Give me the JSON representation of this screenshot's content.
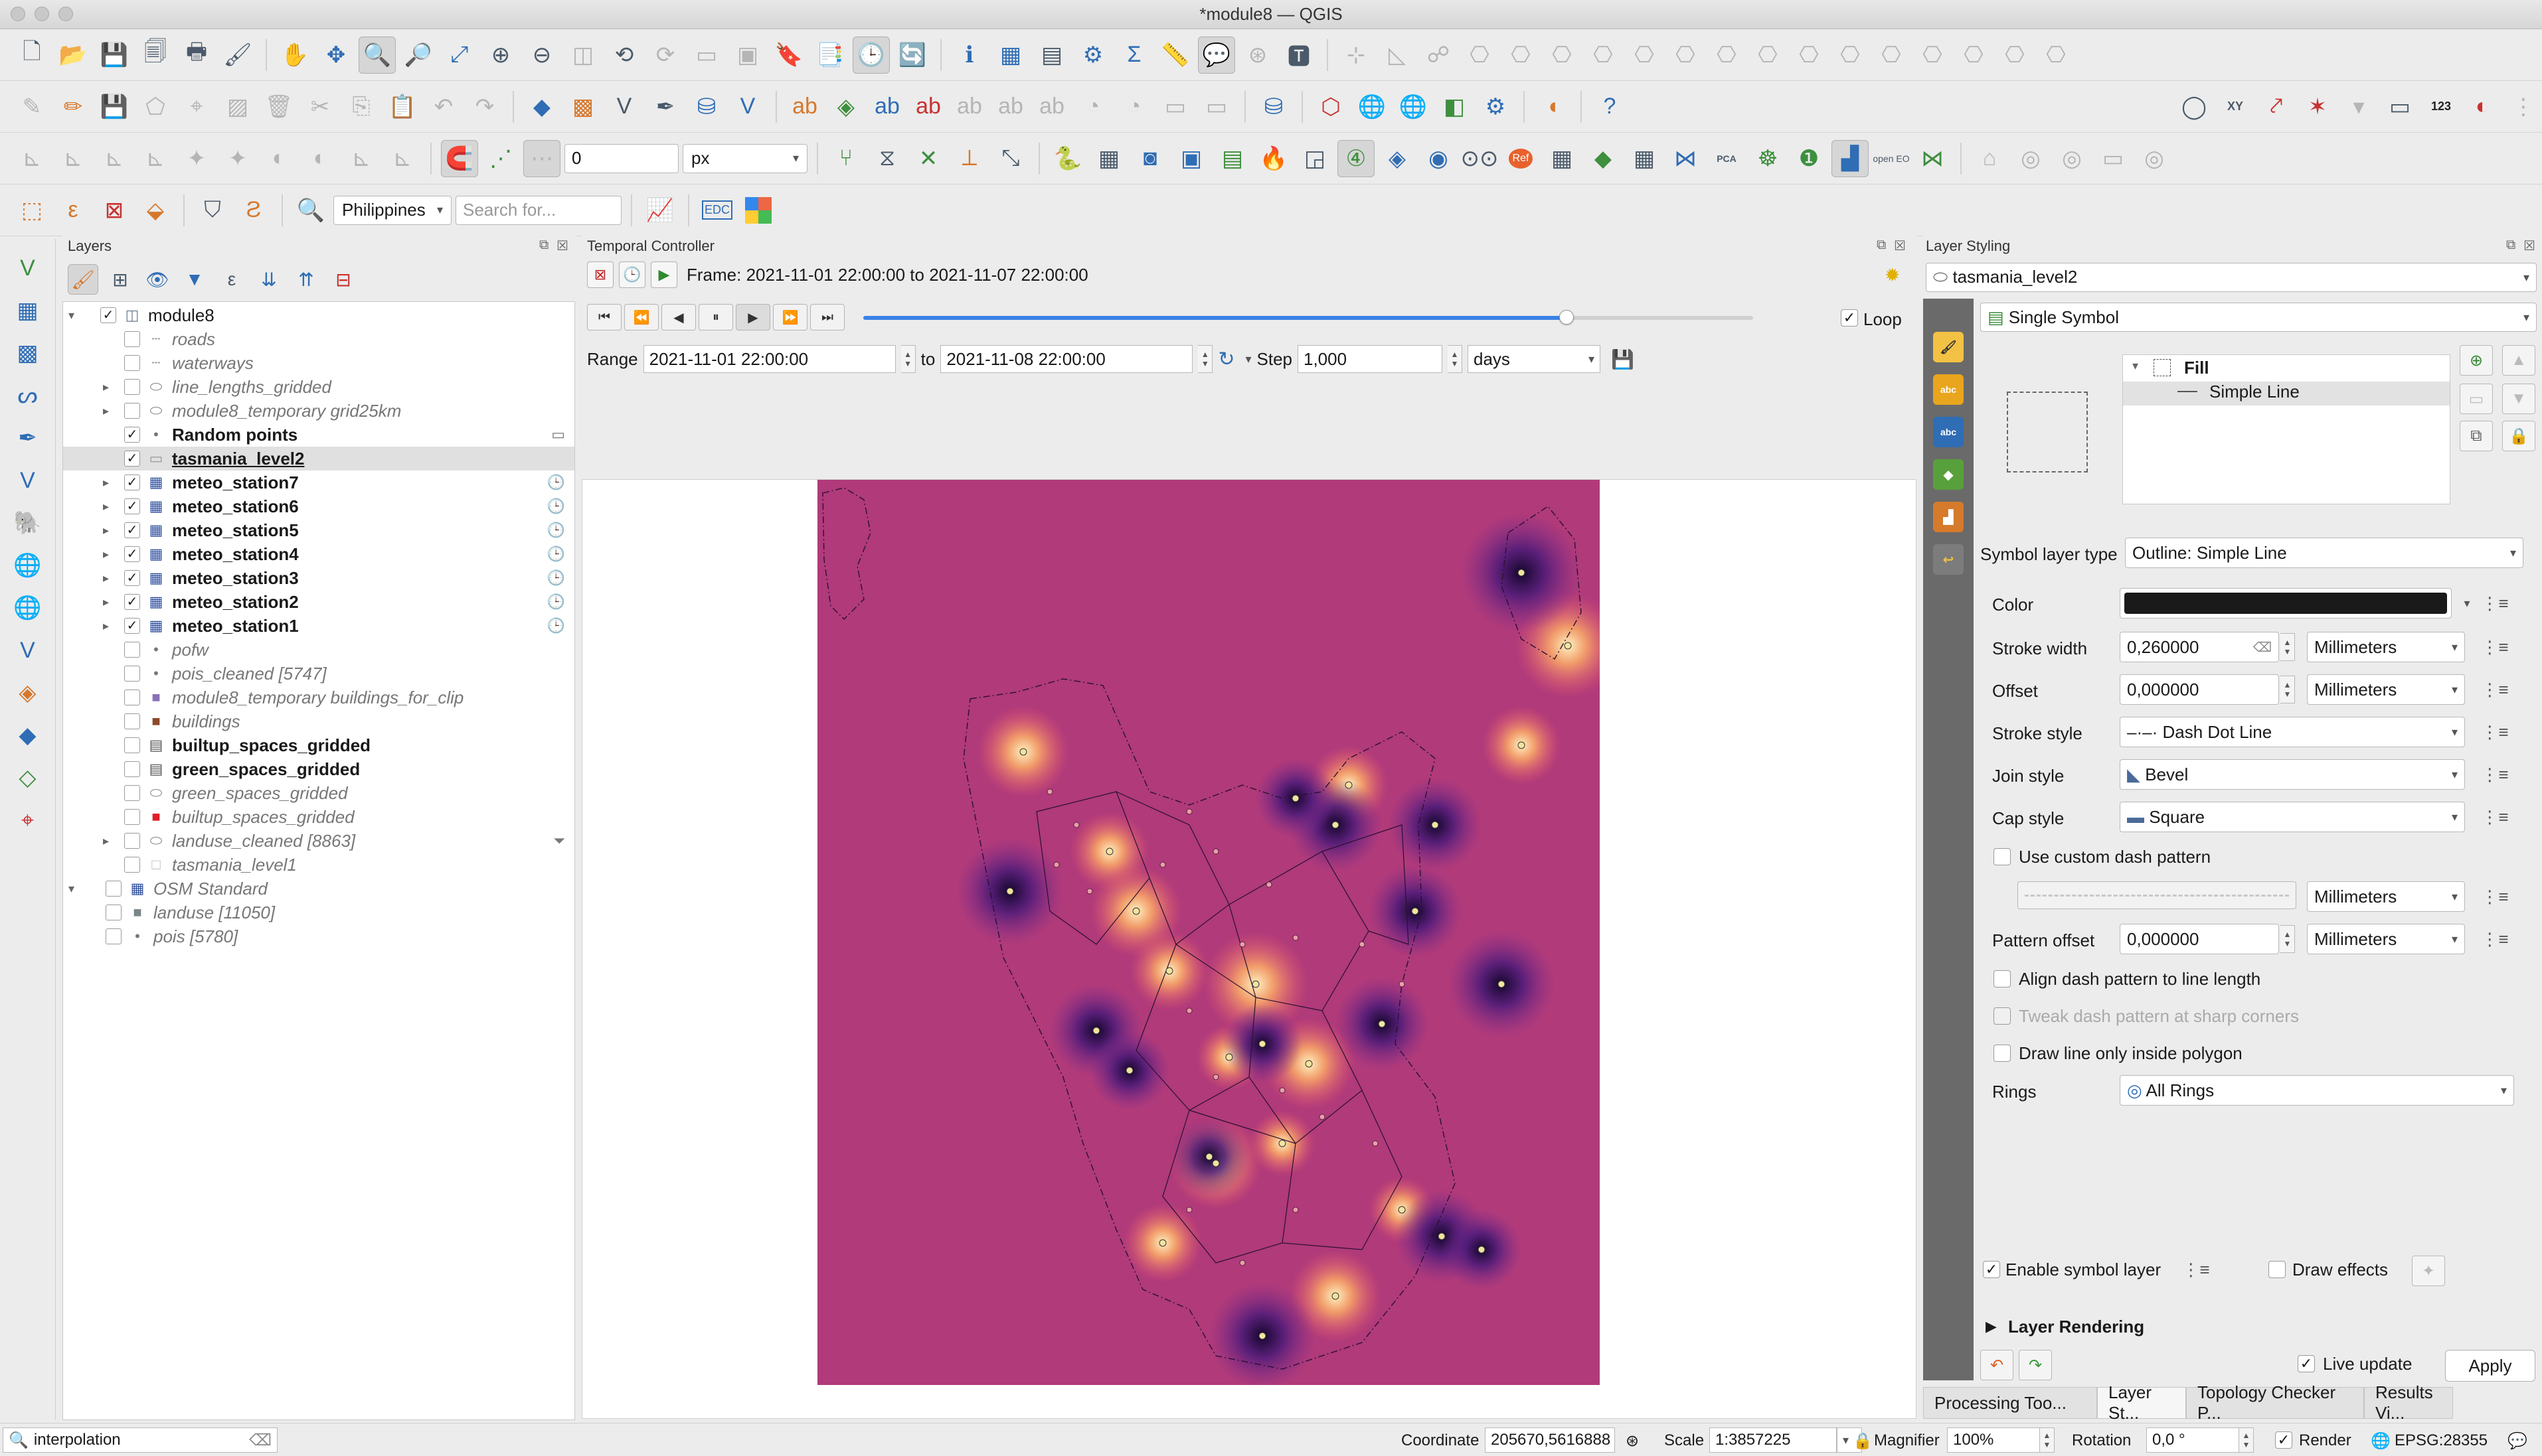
{
  "window": {
    "title": "*module8 — QGIS"
  },
  "toolbar": {
    "snap_value": "0",
    "snap_unit": "px",
    "locale_select": "Philippines",
    "search_placeholder": "Search for...",
    "edc_label": "EDC",
    "n123_label": "123",
    "xy_label": "XY",
    "open_eo_label": "open EO",
    "pca_label": "PCA",
    "ref_label": "Ref"
  },
  "layers_panel": {
    "title": "Layers",
    "items": [
      {
        "label": "module8",
        "style": "normal",
        "checked": true,
        "expand": "open",
        "indent": 0,
        "icon": "project-icon"
      },
      {
        "label": "roads",
        "style": "ital",
        "checked": false,
        "expand": "",
        "indent": 1,
        "icon": "line-icon"
      },
      {
        "label": "waterways",
        "style": "ital",
        "checked": false,
        "expand": "",
        "indent": 1,
        "icon": "line-icon"
      },
      {
        "label": "line_lengths_gridded",
        "style": "ital",
        "checked": false,
        "expand": "closed",
        "indent": 1,
        "icon": "polygon-icon"
      },
      {
        "label": "module8_temporary grid25km",
        "style": "ital",
        "checked": false,
        "expand": "closed",
        "indent": 1,
        "icon": "polygon-icon"
      },
      {
        "label": "Random points",
        "style": "bold",
        "checked": true,
        "expand": "",
        "indent": 1,
        "icon": "point-icon",
        "right": "memory-icon"
      },
      {
        "label": "tasmania_level2",
        "style": "bold",
        "checked": true,
        "expand": "",
        "indent": 1,
        "icon": "polygon-outline-icon",
        "selected": true
      },
      {
        "label": "meteo_station7",
        "style": "bold",
        "checked": true,
        "expand": "closed",
        "indent": 1,
        "icon": "raster-icon",
        "right": "clock-icon"
      },
      {
        "label": "meteo_station6",
        "style": "bold",
        "checked": true,
        "expand": "closed",
        "indent": 1,
        "icon": "raster-icon",
        "right": "clock-icon"
      },
      {
        "label": "meteo_station5",
        "style": "bold",
        "checked": true,
        "expand": "closed",
        "indent": 1,
        "icon": "raster-icon",
        "right": "clock-icon"
      },
      {
        "label": "meteo_station4",
        "style": "bold",
        "checked": true,
        "expand": "closed",
        "indent": 1,
        "icon": "raster-icon",
        "right": "clock-icon"
      },
      {
        "label": "meteo_station3",
        "style": "bold",
        "checked": true,
        "expand": "closed",
        "indent": 1,
        "icon": "raster-icon",
        "right": "clock-icon"
      },
      {
        "label": "meteo_station2",
        "style": "bold",
        "checked": true,
        "expand": "closed",
        "indent": 1,
        "icon": "raster-icon",
        "right": "clock-icon"
      },
      {
        "label": "meteo_station1",
        "style": "bold",
        "checked": true,
        "expand": "closed",
        "indent": 1,
        "icon": "raster-icon",
        "right": "clock-icon"
      },
      {
        "label": "pofw",
        "style": "ital",
        "checked": false,
        "expand": "",
        "indent": 1,
        "icon": "point-icon"
      },
      {
        "label": "pois_cleaned [5747]",
        "style": "ital",
        "checked": false,
        "expand": "",
        "indent": 1,
        "icon": "point-icon"
      },
      {
        "label": "module8_temporary buildings_for_clip",
        "style": "ital",
        "checked": false,
        "expand": "",
        "indent": 1,
        "icon": "purple-fill-icon"
      },
      {
        "label": "buildings",
        "style": "ital",
        "checked": false,
        "expand": "",
        "indent": 1,
        "icon": "brown-fill-icon"
      },
      {
        "label": "builtup_spaces_gridded",
        "style": "bold",
        "checked": false,
        "expand": "",
        "indent": 0,
        "icon": "table-icon"
      },
      {
        "label": "green_spaces_gridded",
        "style": "bold",
        "checked": false,
        "expand": "",
        "indent": 0,
        "icon": "table-icon"
      },
      {
        "label": "green_spaces_gridded",
        "style": "ital",
        "checked": false,
        "expand": "",
        "indent": 1,
        "icon": "polygon-icon"
      },
      {
        "label": "builtup_spaces_gridded",
        "style": "ital",
        "checked": false,
        "expand": "",
        "indent": 1,
        "icon": "red-fill-icon"
      },
      {
        "label": "landuse_cleaned [8863]",
        "style": "ital",
        "checked": false,
        "expand": "closed",
        "indent": 1,
        "icon": "polygon-icon",
        "right": "filter-icon"
      },
      {
        "label": "tasmania_level1",
        "style": "ital",
        "checked": false,
        "expand": "",
        "indent": 1,
        "icon": "empty-fill-icon"
      },
      {
        "label": "OSM Standard",
        "style": "ital",
        "checked": false,
        "expand": "open",
        "indent": -1,
        "icon": "raster-icon"
      },
      {
        "label": "landuse [11050]",
        "style": "ital",
        "checked": false,
        "expand": "",
        "indent": -1,
        "icon": "grey-fill-icon"
      },
      {
        "label": "pois [5780]",
        "style": "ital",
        "checked": false,
        "expand": "",
        "indent": -1,
        "icon": "point-icon"
      }
    ]
  },
  "temporal": {
    "title": "Temporal Controller",
    "frame_text": "Frame: 2021-11-01 22:00:00 to 2021-11-07 22:00:00",
    "progress": 0.79,
    "loop_label": "Loop",
    "range_label": "Range",
    "range_start": "2021-11-01 22:00:00",
    "to_label": "to",
    "range_end": "2021-11-08 22:00:00",
    "step_label": "Step",
    "step_value": "1,000",
    "step_unit": "days"
  },
  "styling": {
    "title": "Layer Styling",
    "layer_select": "tasmania_level2",
    "renderer": "Single Symbol",
    "tree_fill": "Fill",
    "tree_line": "Simple Line",
    "symbol_layer_type_label": "Symbol layer type",
    "symbol_layer_type": "Outline: Simple Line",
    "color_label": "Color",
    "stroke_width_label": "Stroke width",
    "stroke_width": "0,260000",
    "stroke_width_unit": "Millimeters",
    "offset_label": "Offset",
    "offset": "0,000000",
    "offset_unit": "Millimeters",
    "stroke_style_label": "Stroke style",
    "stroke_style": "Dash Dot Line",
    "join_style_label": "Join style",
    "join_style": "Bevel",
    "cap_style_label": "Cap style",
    "cap_style": "Square",
    "custom_dash_label": "Use custom dash pattern",
    "custom_dash_unit": "Millimeters",
    "pattern_offset_label": "Pattern offset",
    "pattern_offset": "0,000000",
    "pattern_offset_unit": "Millimeters",
    "align_dash_label": "Align dash pattern to line length",
    "tweak_dash_label": "Tweak dash pattern at sharp corners",
    "draw_inside_label": "Draw line only inside polygon",
    "rings_label": "Rings",
    "rings": "All Rings",
    "enable_layer_label": "Enable symbol layer",
    "draw_effects_label": "Draw effects",
    "layer_rendering_label": "Layer Rendering",
    "live_update_label": "Live update",
    "apply_label": "Apply"
  },
  "bottom_tabs": [
    "Processing Too...",
    "Layer St...",
    "Topology Checker P...",
    "Results Vi..."
  ],
  "status": {
    "search": "interpolation",
    "coordinate_label": "Coordinate",
    "coordinate": "205670,5616888",
    "scale_label": "Scale",
    "scale": "1:3857225",
    "magnifier_label": "Magnifier",
    "magnifier": "100%",
    "rotation_label": "Rotation",
    "rotation": "0,0 °",
    "render_label": "Render",
    "crs": "EPSG:28355"
  },
  "colors": {
    "map_base": "#b03a7a",
    "heat_low": "#2a0a4a",
    "heat_high": "#fde3a5",
    "slider": "#3b82e6"
  }
}
